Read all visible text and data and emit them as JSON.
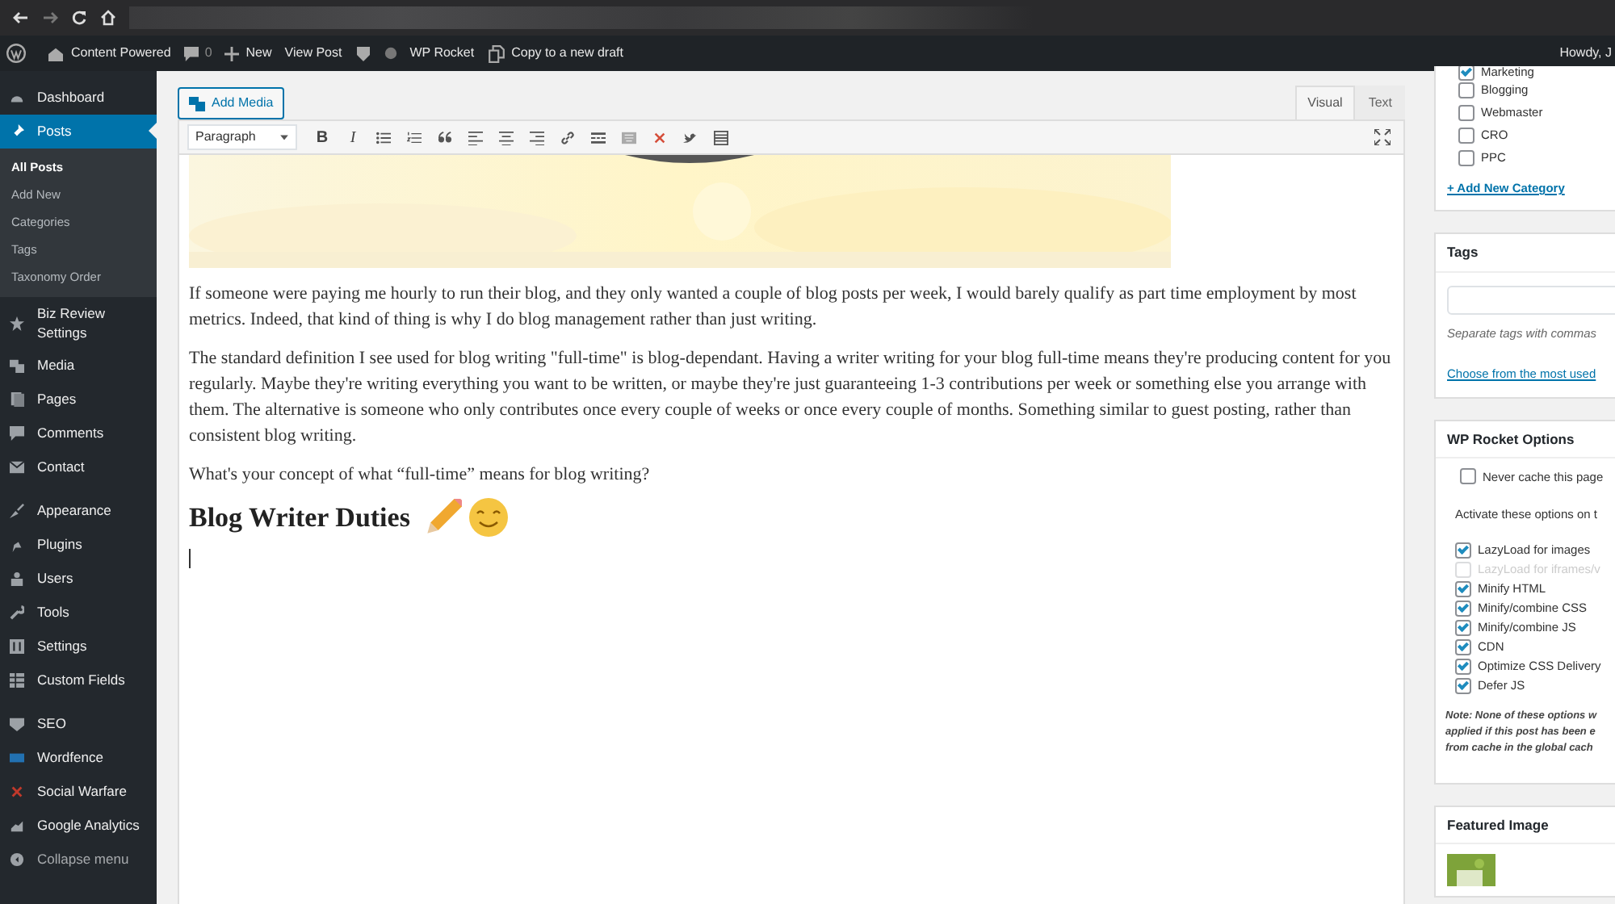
{
  "admin_bar": {
    "site": "Content Powered",
    "comments": "0",
    "new": "New",
    "view_post": "View Post",
    "rocket": "WP Rocket",
    "copy": "Copy to a new draft",
    "howdy": "Howdy, J"
  },
  "menu_groups": [
    [
      {
        "label": "Dashboard",
        "selected": false
      },
      {
        "label": "Posts",
        "selected": true,
        "children": [
          {
            "label": "All Posts",
            "selected": true
          },
          {
            "label": "Add New",
            "selected": false
          },
          {
            "label": "Categories",
            "selected": false
          },
          {
            "label": "Tags",
            "selected": false
          },
          {
            "label": "Taxonomy Order",
            "selected": false
          }
        ]
      },
      {
        "label": "Biz Review Settings",
        "selected": false
      },
      {
        "label": "Media",
        "selected": false
      },
      {
        "label": "Pages",
        "selected": false
      },
      {
        "label": "Comments",
        "selected": false
      },
      {
        "label": "Contact",
        "selected": false
      }
    ],
    [
      {
        "label": "Appearance",
        "selected": false
      },
      {
        "label": "Plugins",
        "selected": false
      },
      {
        "label": "Users",
        "selected": false
      },
      {
        "label": "Tools",
        "selected": false
      },
      {
        "label": "Settings",
        "selected": false
      },
      {
        "label": "Custom Fields",
        "selected": false
      }
    ],
    [
      {
        "label": "SEO",
        "selected": false
      },
      {
        "label": "Wordfence",
        "selected": false
      },
      {
        "label": "Social Warfare",
        "selected": false
      },
      {
        "label": "Google Analytics",
        "selected": false
      },
      {
        "label": "Collapse menu",
        "selected": false
      }
    ]
  ],
  "editor": {
    "add_media": "Add Media",
    "tabs": [
      {
        "label": "Visual",
        "selected": true
      },
      {
        "label": "Text",
        "selected": false
      }
    ],
    "format": "Paragraph",
    "glyphs": [
      "B",
      "I"
    ],
    "paragraphs": [
      "If someone were paying me hourly to run their blog, and they only wanted a couple of blog posts per week, I would barely qualify as part time employment by most metrics. Indeed, that kind of thing is why I do blog management rather than just writing.",
      "The standard definition I see used for blog writing \"full-time\" is blog-dependant. Having a writer writing for your blog full-time means they're producing content for you regularly. Maybe they're writing everything you want to be written, or maybe they're just guaranteeing 1-3 contributions per week or something else you arrange with them. The alternative is someone who only contributes once every couple of weeks or once every couple of months. Something similar to guest posting, rather than consistent blog writing.",
      "What's your concept of what “full-time” means for blog writing?"
    ],
    "heading": "Blog Writer Duties"
  },
  "categories": {
    "items": [
      {
        "label": "Marketing",
        "checked": true
      },
      {
        "label": "Blogging",
        "checked": false
      },
      {
        "label": "Webmaster",
        "checked": false
      },
      {
        "label": "CRO",
        "checked": false
      },
      {
        "label": "PPC",
        "checked": false
      }
    ],
    "add_link": "+ Add New Category"
  },
  "tags": {
    "title": "Tags",
    "hint": "Separate tags with commas",
    "link": "Choose from the most used"
  },
  "wp_rocket": {
    "title": "WP Rocket Options",
    "never_cache": {
      "label": "Never cache this page",
      "checked": false
    },
    "intro": "Activate these options on t",
    "options": [
      {
        "label": "LazyLoad for images",
        "checked": true,
        "disabled": false
      },
      {
        "label": "LazyLoad for iframes/v",
        "checked": false,
        "disabled": true
      },
      {
        "label": "Minify HTML",
        "checked": true,
        "disabled": false
      },
      {
        "label": "Minify/combine CSS",
        "checked": true,
        "disabled": false
      },
      {
        "label": "Minify/combine JS",
        "checked": true,
        "disabled": false
      },
      {
        "label": "CDN",
        "checked": true,
        "disabled": false
      },
      {
        "label": "Optimize CSS Delivery",
        "checked": true,
        "disabled": false
      },
      {
        "label": "Defer JS",
        "checked": true,
        "disabled": false
      }
    ],
    "note_lines": [
      "Note: None of these options w",
      "applied if this post has been e",
      "from cache in the global cach"
    ]
  },
  "featured": {
    "title": "Featured Image"
  }
}
